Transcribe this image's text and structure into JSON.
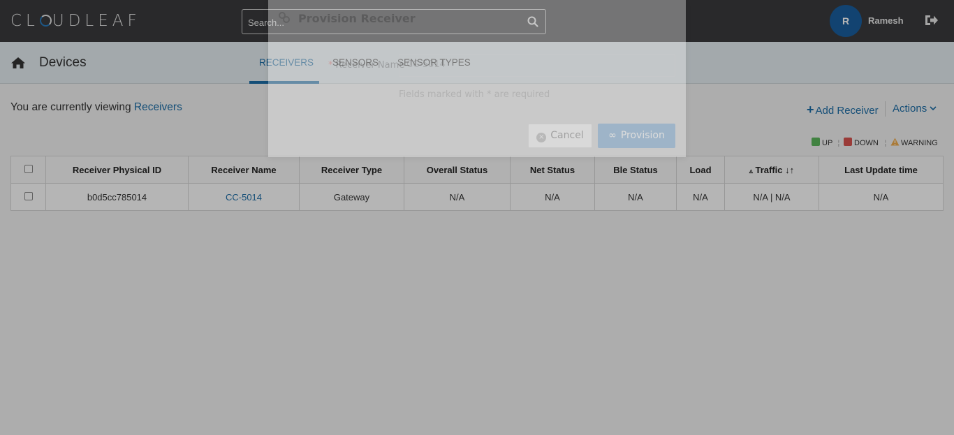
{
  "header": {
    "logo_text": "CLOUDLEAF",
    "search_placeholder": "Search...",
    "avatar_initial": "R",
    "user_name": "Ramesh"
  },
  "subheader": {
    "title": "Devices",
    "tabs": [
      {
        "label": "RECEIVERS",
        "active": true
      },
      {
        "label": "SENSORS",
        "active": false
      },
      {
        "label": "SENSOR TYPES",
        "active": false
      }
    ]
  },
  "content": {
    "viewing_prefix": "You are currently viewing",
    "viewing_target": "Receivers",
    "add_receiver_label": "Add Receiver",
    "actions_label": "Actions",
    "legend": [
      {
        "label": "UP",
        "color": "#5cb85c"
      },
      {
        "label": "DOWN",
        "color": "#d9534f"
      },
      {
        "label": "WARNING",
        "color": "#f0ad4e"
      }
    ]
  },
  "table": {
    "columns": [
      "Receiver Physical ID",
      "Receiver Name",
      "Receiver Type",
      "Overall Status",
      "Net Status",
      "Ble Status",
      "Load",
      "Traffic",
      "Last Update time"
    ],
    "rows": [
      [
        "b0d5cc785014",
        "CC-5014",
        "Gateway",
        "N/A",
        "N/A",
        "N/A",
        "N/A",
        "N/A | N/A",
        "N/A"
      ]
    ]
  },
  "modal": {
    "title": "Provision Receiver",
    "field_label": "Receiver Name",
    "field_value": "CC-5014",
    "required_note": "Fields marked with * are required",
    "cancel_label": "Cancel",
    "provision_label": "Provision"
  },
  "colors": {
    "topbar": "#3a3b3d",
    "accent": "#1d6ea8",
    "avatar": "#1a5fa0"
  }
}
